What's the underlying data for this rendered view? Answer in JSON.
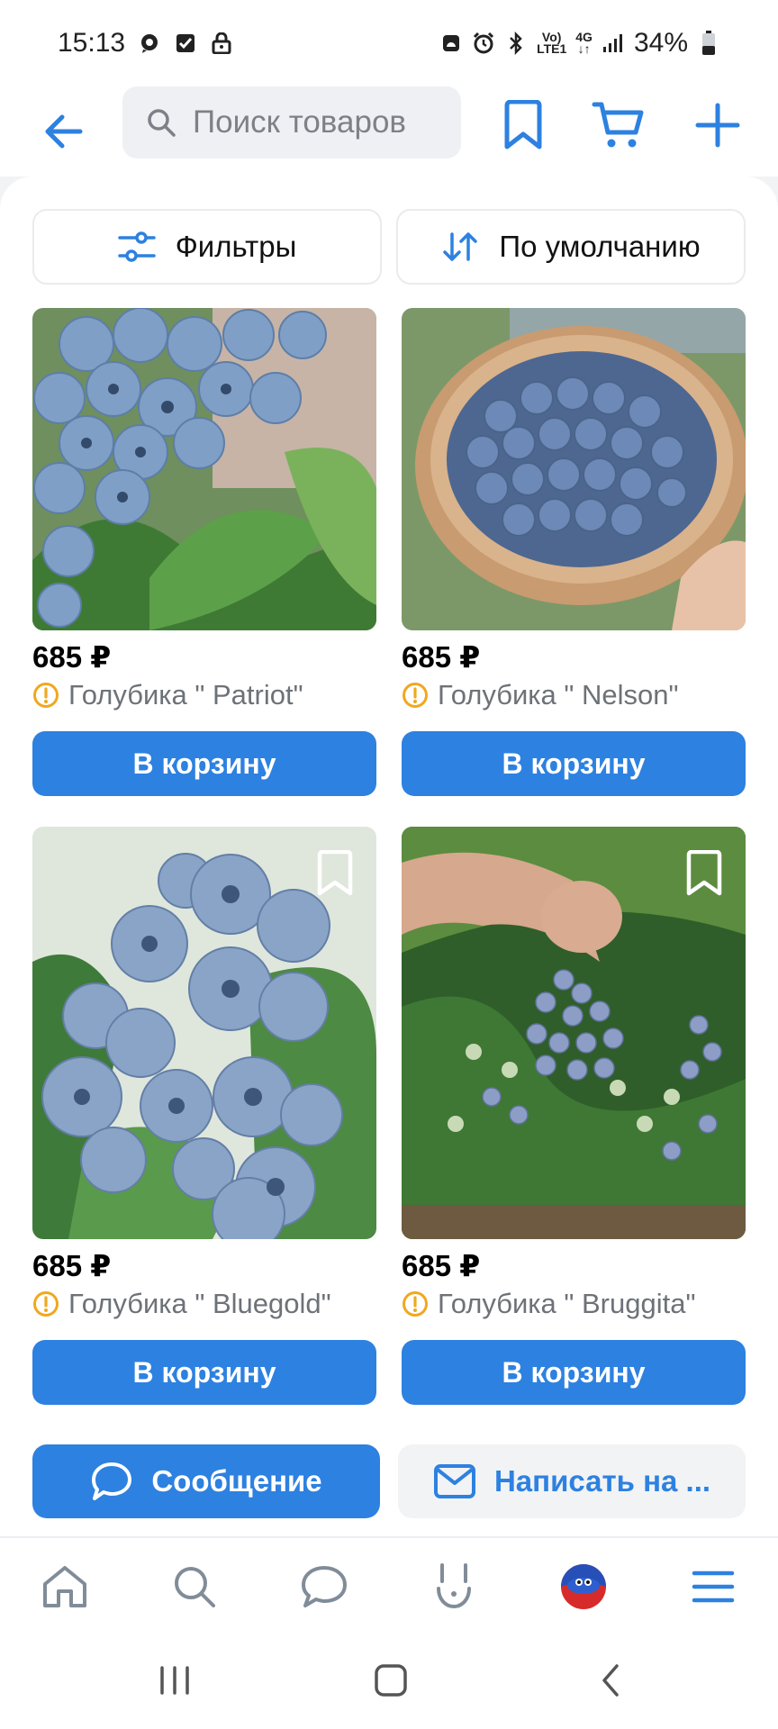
{
  "status_bar": {
    "time": "15:13",
    "battery": "34%",
    "network_type": "4G",
    "volte_top": "Vo)",
    "volte_bottom": "LTE1"
  },
  "toolbar": {
    "search_placeholder": "Поиск товаров"
  },
  "filters": {
    "filters_label": "Фильтры",
    "sort_label": "По умолчанию"
  },
  "products": [
    {
      "price": "685 ₽",
      "name": "Голубика \" Patriot\"",
      "button": "В корзину"
    },
    {
      "price": "685 ₽",
      "name": "Голубика \" Nelson\"",
      "button": "В корзину"
    },
    {
      "price": "685 ₽",
      "name": "Голубика \" Bluegold\"",
      "button": "В корзину"
    },
    {
      "price": "685 ₽",
      "name": "Голубика \" Bruggita\"",
      "button": "В корзину"
    }
  ],
  "actions": {
    "message_label": "Сообщение",
    "email_label": "Написать на ..."
  },
  "colors": {
    "accent": "#2d81e0",
    "warning": "#f0a81e",
    "search_bg": "#eef0f3"
  },
  "icons": [
    "back-arrow-icon",
    "search-icon",
    "bookmark-icon",
    "cart-icon",
    "plus-icon",
    "filter-sliders-icon",
    "sort-arrows-icon",
    "warning-icon",
    "chat-bubble-icon",
    "mail-icon",
    "home-icon",
    "messenger-icon",
    "clips-icon",
    "avatar",
    "menu-icon"
  ]
}
